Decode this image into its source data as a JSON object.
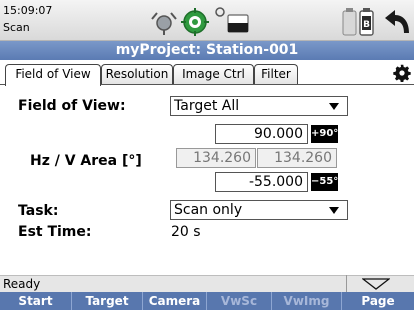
{
  "status": {
    "time": "15:09:07",
    "mode": "Scan",
    "battery_label": "B"
  },
  "title": "myProject: Station-001",
  "tabs": [
    {
      "label": "Field of View",
      "active": true
    },
    {
      "label": "Resolution",
      "active": false
    },
    {
      "label": "Image Ctrl",
      "active": false
    },
    {
      "label": "Filter",
      "active": false
    }
  ],
  "form": {
    "fov_label": "Field of View:",
    "fov_value": "Target All",
    "area_label": "Hz / V Area [°]",
    "v_top": "90.000",
    "v_top_badge": "+90°",
    "hz_left": "134.260",
    "hz_right": "134.260",
    "v_bottom": "-55.000",
    "v_bottom_badge": "−55°",
    "task_label": "Task:",
    "task_value": "Scan only",
    "est_label": "Est Time:",
    "est_value": "20 s"
  },
  "statusline": "Ready",
  "fkeys": [
    {
      "label": "Start",
      "enabled": true
    },
    {
      "label": "Target",
      "enabled": true
    },
    {
      "label": "Camera",
      "enabled": true
    },
    {
      "label": "VwSc",
      "enabled": false
    },
    {
      "label": "VwImg",
      "enabled": false
    },
    {
      "label": "Page",
      "enabled": true
    }
  ],
  "colors": {
    "title_bar": "#5b7bb3",
    "fkey_bar": "#5877ae",
    "badge": "#000000"
  }
}
